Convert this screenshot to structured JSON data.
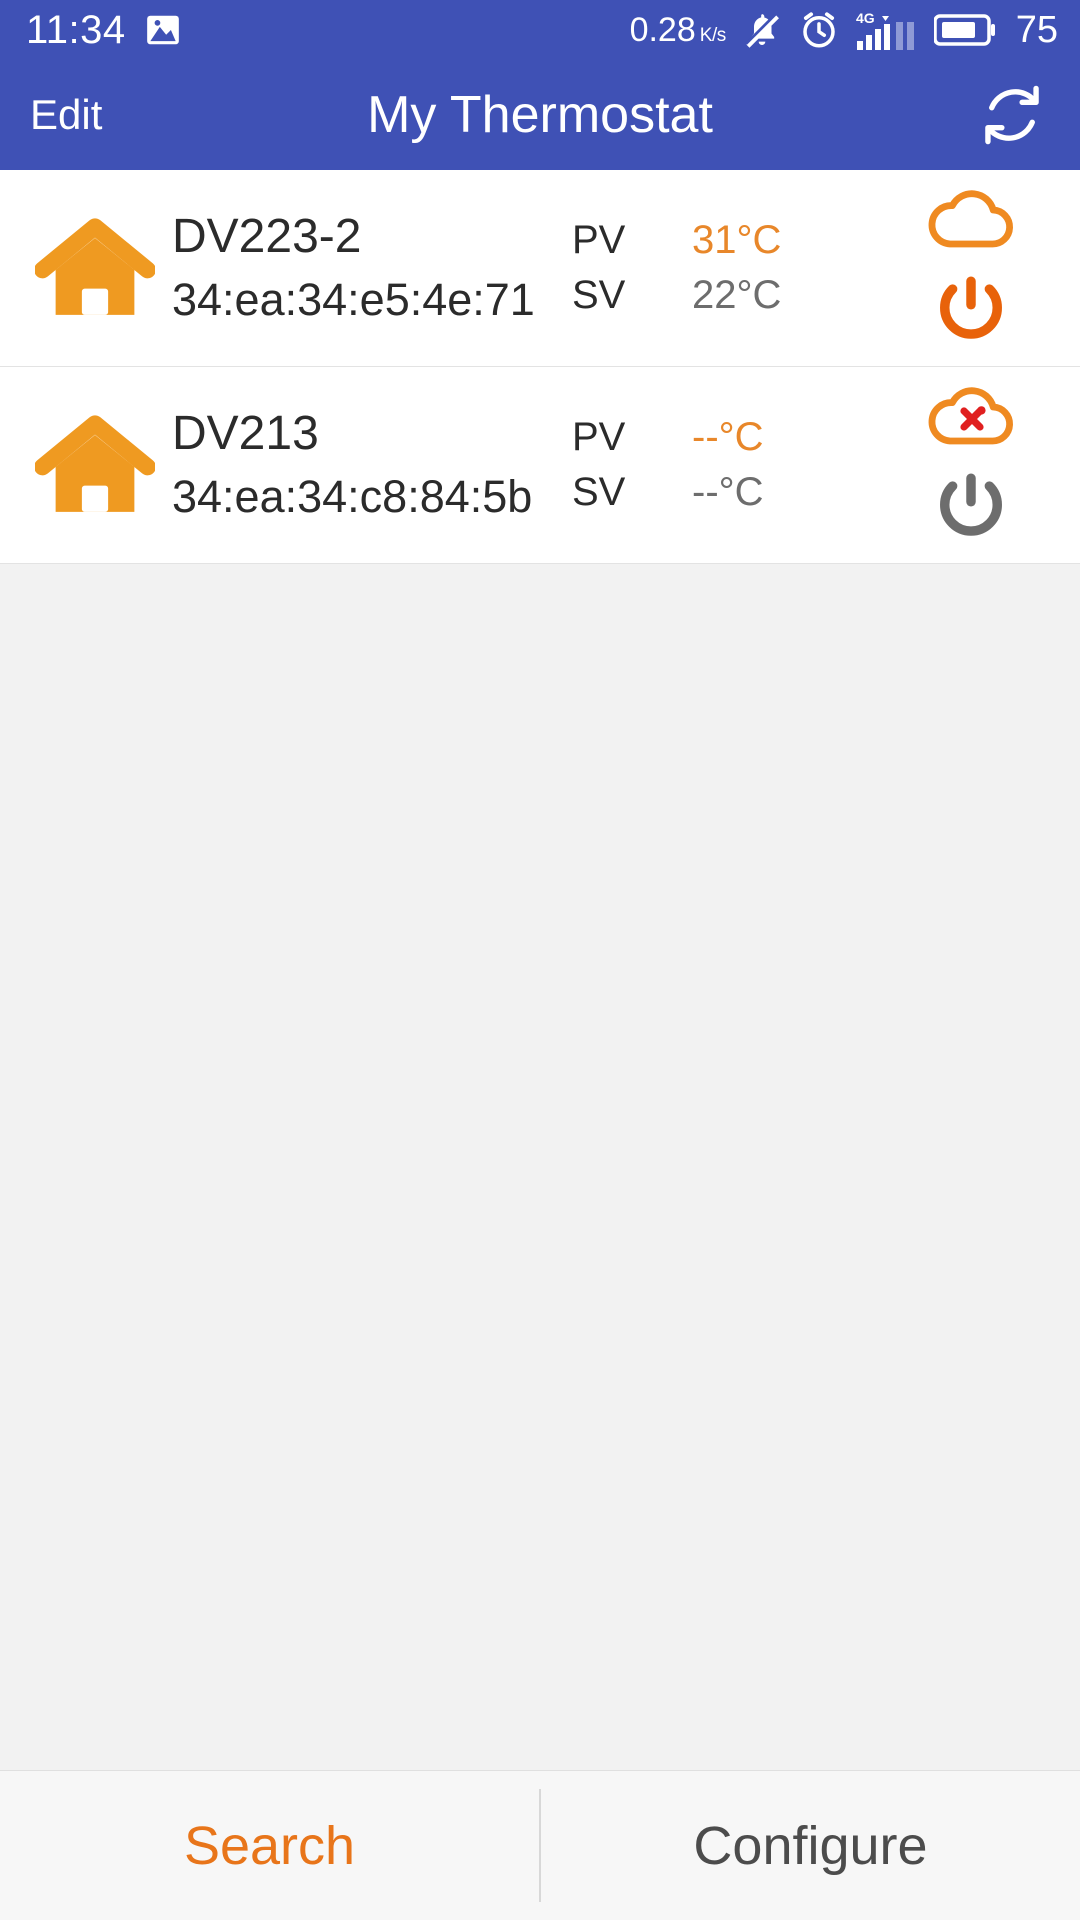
{
  "status_bar": {
    "time": "11:34",
    "image_icon": "image-icon",
    "network_speed": "0.28",
    "network_speed_unit": "K/s",
    "mute_icon": "bell-muted-icon",
    "alarm_icon": "alarm-clock-icon",
    "network_type": "4G",
    "signal_icon": "signal-bars-icon",
    "battery_icon": "battery-icon",
    "battery_level": "75",
    "background_color": "#3f51b5"
  },
  "app_bar": {
    "edit_label": "Edit",
    "title": "My Thermostat",
    "refresh_icon": "refresh-icon",
    "background_color": "#3f51b5"
  },
  "devices": [
    {
      "house_icon": "house-icon",
      "name": "DV223-2",
      "mac": "34:ea:34:e5:4e:71",
      "pv_label": "PV",
      "pv_value": "31°C",
      "sv_label": "SV",
      "sv_value": "22°C",
      "cloud_icon": "cloud-connected-icon",
      "cloud_state": "connected",
      "power_icon": "power-icon",
      "power_state": "on"
    },
    {
      "house_icon": "house-icon",
      "name": "DV213",
      "mac": "34:ea:34:c8:84:5b",
      "pv_label": "PV",
      "pv_value": "--°C",
      "sv_label": "SV",
      "sv_value": "--°C",
      "cloud_icon": "cloud-disconnected-icon",
      "cloud_state": "disconnected",
      "power_icon": "power-icon",
      "power_state": "off"
    }
  ],
  "bottom_bar": {
    "search_label": "Search",
    "configure_label": "Configure"
  },
  "colors": {
    "accent_blue": "#3f51b5",
    "accent_orange": "#e8872a",
    "house_orange": "#ef9a21",
    "power_on_orange": "#e8620a",
    "power_off_gray": "#6d6d6d",
    "error_red": "#e02020",
    "search_orange": "#e8751a"
  }
}
